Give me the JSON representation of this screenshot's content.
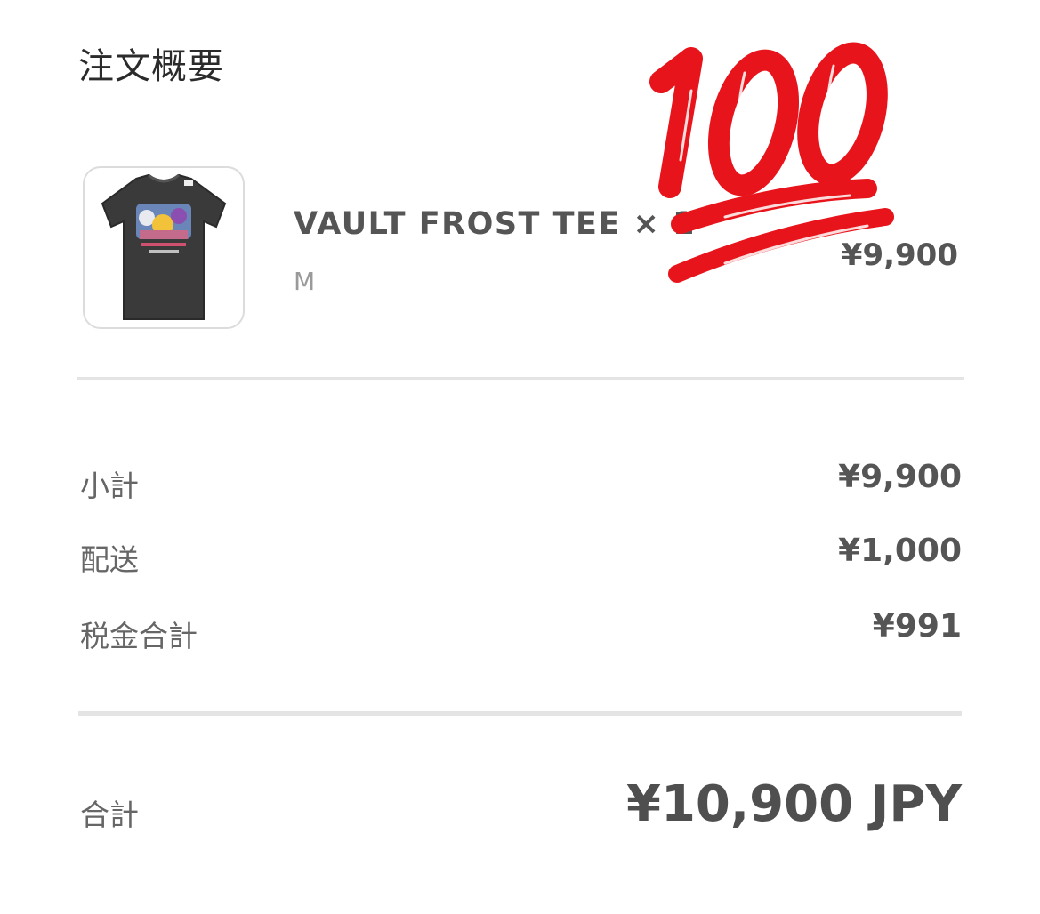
{
  "summary": {
    "title": "注文概要"
  },
  "item": {
    "name": "VAULT FROST TEE × 1",
    "variant": "M",
    "price": "¥9,900",
    "image_icon": "tshirt-thumbnail"
  },
  "sticker": {
    "icon": "hundred-points-icon",
    "color": "#e8141b"
  },
  "rows": [
    {
      "label": "小計",
      "value": "¥9,900"
    },
    {
      "label": "配送",
      "value": "¥1,000"
    },
    {
      "label": "税金合計",
      "value": "¥991"
    }
  ],
  "total": {
    "label": "合計",
    "value": "¥10,900 JPY"
  }
}
